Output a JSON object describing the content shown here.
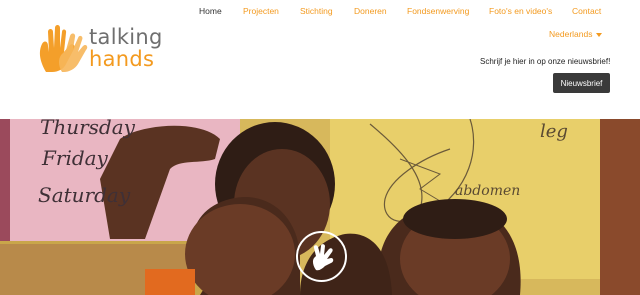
{
  "logo": {
    "line1": "talking",
    "line2": "hands",
    "icon": "hands-logo-icon"
  },
  "nav": {
    "items": [
      {
        "label": "Home",
        "active": true
      },
      {
        "label": "Projecten",
        "active": false
      },
      {
        "label": "Stichting",
        "active": false
      },
      {
        "label": "Doneren",
        "active": false
      },
      {
        "label": "Fondsenwerving",
        "active": false
      },
      {
        "label": "Foto's en video's",
        "active": false
      },
      {
        "label": "Contact",
        "active": false
      }
    ]
  },
  "language": {
    "selected": "Nederlands",
    "icon": "caret-down-icon"
  },
  "newsletter": {
    "text": "Schrijf je hier in op onze nieuwsbrief!",
    "button_label": "Nieuwsbrief"
  },
  "hero": {
    "board_words": [
      "Thursday",
      "Friday",
      "Saturday"
    ],
    "wall_words": [
      "leg",
      "abdomen"
    ],
    "play_icon": "sign-language-hand-icon"
  },
  "colors": {
    "accent": "#f39a1f",
    "text_dark": "#333333",
    "button_bg": "#3a3a3a"
  }
}
